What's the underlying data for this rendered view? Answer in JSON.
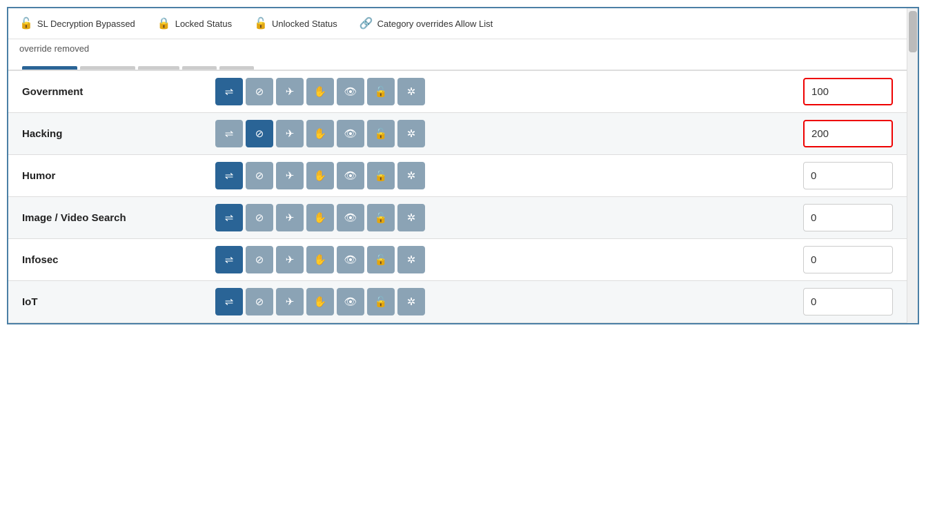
{
  "legend": {
    "items": [
      {
        "id": "ssl-bypass",
        "icon": "🔓",
        "label": "SL Decryption Bypassed"
      },
      {
        "id": "locked",
        "icon": "🔒",
        "label": "Locked Status"
      },
      {
        "id": "unlocked",
        "icon": "🔓",
        "label": "Unlocked Status"
      },
      {
        "id": "category-override",
        "icon": "🔗",
        "label": "Category overrides Allow List"
      }
    ]
  },
  "sub_text": "override removed",
  "tabs": [
    {
      "id": "tab1",
      "active": true,
      "color": "#2a6496"
    },
    {
      "id": "tab2",
      "active": false,
      "color": "#bbb"
    },
    {
      "id": "tab3",
      "active": false,
      "color": "#bbb"
    },
    {
      "id": "tab4",
      "active": false,
      "color": "#bbb"
    },
    {
      "id": "tab5",
      "active": false,
      "color": "#bbb"
    }
  ],
  "rows": [
    {
      "id": "government",
      "label": "Government",
      "icons": [
        {
          "id": "arrows",
          "symbol": "⇌",
          "active": true
        },
        {
          "id": "block",
          "symbol": "⊘",
          "active": false
        },
        {
          "id": "plane",
          "symbol": "✈",
          "active": false
        },
        {
          "id": "hand",
          "symbol": "✋",
          "active": false
        },
        {
          "id": "eye",
          "symbol": "👁",
          "active": false
        },
        {
          "id": "unlock",
          "symbol": "🔓",
          "active": false
        },
        {
          "id": "spin",
          "symbol": "✲",
          "active": false
        }
      ],
      "value": "100",
      "highlighted": true
    },
    {
      "id": "hacking",
      "label": "Hacking",
      "icons": [
        {
          "id": "arrows",
          "symbol": "⇌",
          "active": false
        },
        {
          "id": "block",
          "symbol": "⊘",
          "active": true
        },
        {
          "id": "plane",
          "symbol": "✈",
          "active": false
        },
        {
          "id": "hand",
          "symbol": "✋",
          "active": false
        },
        {
          "id": "eye",
          "symbol": "👁",
          "active": false
        },
        {
          "id": "unlock",
          "symbol": "🔓",
          "active": false
        },
        {
          "id": "spin",
          "symbol": "✲",
          "active": false
        }
      ],
      "value": "200",
      "highlighted": true
    },
    {
      "id": "humor",
      "label": "Humor",
      "icons": [
        {
          "id": "arrows",
          "symbol": "⇌",
          "active": true
        },
        {
          "id": "block",
          "symbol": "⊘",
          "active": false
        },
        {
          "id": "plane",
          "symbol": "✈",
          "active": false
        },
        {
          "id": "hand",
          "symbol": "✋",
          "active": false
        },
        {
          "id": "eye",
          "symbol": "👁",
          "active": false
        },
        {
          "id": "unlock",
          "symbol": "🔓",
          "active": false
        },
        {
          "id": "spin",
          "symbol": "✲",
          "active": false
        }
      ],
      "value": "0",
      "highlighted": false
    },
    {
      "id": "image-video-search",
      "label": "Image / Video Search",
      "icons": [
        {
          "id": "arrows",
          "symbol": "⇌",
          "active": true
        },
        {
          "id": "block",
          "symbol": "⊘",
          "active": false
        },
        {
          "id": "plane",
          "symbol": "✈",
          "active": false
        },
        {
          "id": "hand",
          "symbol": "✋",
          "active": false
        },
        {
          "id": "eye",
          "symbol": "👁",
          "active": false
        },
        {
          "id": "unlock",
          "symbol": "🔓",
          "active": false
        },
        {
          "id": "spin",
          "symbol": "✲",
          "active": false
        }
      ],
      "value": "0",
      "highlighted": false
    },
    {
      "id": "infosec",
      "label": "Infosec",
      "icons": [
        {
          "id": "arrows",
          "symbol": "⇌",
          "active": true
        },
        {
          "id": "block",
          "symbol": "⊘",
          "active": false
        },
        {
          "id": "plane",
          "symbol": "✈",
          "active": false
        },
        {
          "id": "hand",
          "symbol": "✋",
          "active": false
        },
        {
          "id": "eye",
          "symbol": "👁",
          "active": false
        },
        {
          "id": "unlock",
          "symbol": "🔓",
          "active": false
        },
        {
          "id": "spin",
          "symbol": "✲",
          "active": false
        }
      ],
      "value": "0",
      "highlighted": false
    },
    {
      "id": "iot",
      "label": "IoT",
      "icons": [
        {
          "id": "arrows",
          "symbol": "⇌",
          "active": true
        },
        {
          "id": "block",
          "symbol": "⊘",
          "active": false
        },
        {
          "id": "plane",
          "symbol": "✈",
          "active": false
        },
        {
          "id": "hand",
          "symbol": "✋",
          "active": false
        },
        {
          "id": "eye",
          "symbol": "👁",
          "active": false
        },
        {
          "id": "unlock",
          "symbol": "🔓",
          "active": false
        },
        {
          "id": "spin",
          "symbol": "✲",
          "active": false
        }
      ],
      "value": "0",
      "highlighted": false
    }
  ],
  "icons": {
    "arrows": "⇌",
    "block": "⊘",
    "plane": "✈",
    "hand": "✋",
    "eye": "👁",
    "unlock": "🔓",
    "spin": "✲",
    "lock": "🔒",
    "link": "🔗"
  }
}
